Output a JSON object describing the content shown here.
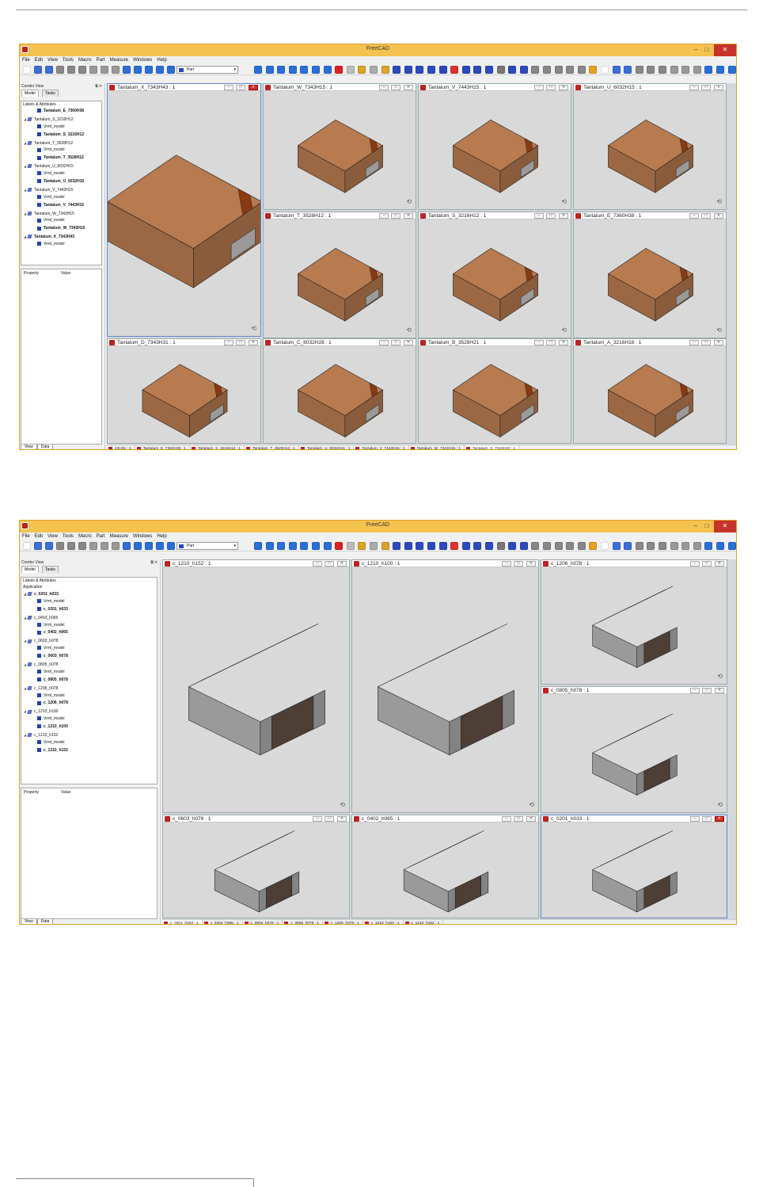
{
  "window1": {
    "title": "FreeCAD",
    "menu": [
      "File",
      "Edit",
      "View",
      "Tools",
      "Macro",
      "Part",
      "Measure",
      "Windows",
      "Help"
    ],
    "workbench": "Part",
    "combo_view": "Combo View",
    "tabs": [
      "Model",
      "Tasks"
    ],
    "tree_header": "Labels & Attributes",
    "tree": [
      {
        "label": "Tantalum_E_7360H38",
        "level": 1,
        "bold": true
      },
      {
        "label": "Tantalum_S_3216H12",
        "level": 0,
        "bold": false
      },
      {
        "label": "Vrml_model",
        "level": 1,
        "bold": false
      },
      {
        "label": "Tantalum_S_3216H12",
        "level": 1,
        "bold": true
      },
      {
        "label": "Tantalum_T_3528H12",
        "level": 0,
        "bold": false
      },
      {
        "label": "Vrml_model",
        "level": 1,
        "bold": false
      },
      {
        "label": "Tantalum_T_3528H12",
        "level": 1,
        "bold": true
      },
      {
        "label": "Tantalum_U_6032H15",
        "level": 0,
        "bold": false
      },
      {
        "label": "Vrml_model",
        "level": 1,
        "bold": false
      },
      {
        "label": "Tantalum_U_6032H15",
        "level": 1,
        "bold": true
      },
      {
        "label": "Tantalum_V_7443H15",
        "level": 0,
        "bold": false
      },
      {
        "label": "Vrml_model",
        "level": 1,
        "bold": false
      },
      {
        "label": "Tantalum_V_7443H15",
        "level": 1,
        "bold": true
      },
      {
        "label": "Tantalum_W_7343H15",
        "level": 0,
        "bold": false
      },
      {
        "label": "Vrml_model",
        "level": 1,
        "bold": false
      },
      {
        "label": "Tantalum_W_7343H15",
        "level": 1,
        "bold": true
      },
      {
        "label": "Tantalum_X_7343H43",
        "level": 0,
        "bold": true
      },
      {
        "label": "Vrml_model",
        "level": 1,
        "bold": false
      }
    ],
    "prop_cols": [
      "Property",
      "Value"
    ],
    "bottom_tabs": [
      "View",
      "Data"
    ],
    "views": [
      "Tantalum_X_7343H43 : 1",
      "Tantalum_W_7343H15 : 1",
      "Tantalum_V_7443H15 : 1",
      "Tantalum_U_6032H15 : 1",
      "Tantalum_T_3528H12 : 1",
      "Tantalum_S_3216H12 : 1",
      "Tantalum_E_7360H38 : 1",
      "Tantalum_D_7343H31 : 1",
      "Tantalum_C_6032H28 : 1",
      "Tantalum_B_3528H21 : 1",
      "Tantalum_A_3216H18 : 1"
    ],
    "doc_tabs": [
      "43H31 : 1",
      "Tantalum_E_7360H38 : 1",
      "Tantalum_S_3216H12 : 1",
      "Tantalum_T_3528H12 : 1",
      "Tantalum_U_6032H15 : 1",
      "Tantalum_V_7443H15 : 1",
      "Tantalum_W_7343H15 : 1",
      "Tantalum_X_7343H43 : 1"
    ]
  },
  "window2": {
    "title": "FreeCAD",
    "menu": [
      "File",
      "Edit",
      "View",
      "Tools",
      "Macro",
      "Part",
      "Measure",
      "Windows",
      "Help"
    ],
    "workbench": "Part",
    "combo_view": "Combo View",
    "tabs": [
      "Model",
      "Tasks"
    ],
    "tree_header": "Labels & Attributes",
    "tree_app": "Application",
    "tree": [
      {
        "label": "c_0201_h033",
        "level": 0,
        "bold": true
      },
      {
        "label": "Vrml_model",
        "level": 1,
        "bold": false
      },
      {
        "label": "c_0201_h033",
        "level": 1,
        "bold": true
      },
      {
        "label": "c_0402_h065",
        "level": 0,
        "bold": false
      },
      {
        "label": "Vrml_model",
        "level": 1,
        "bold": false
      },
      {
        "label": "c_0402_h065",
        "level": 1,
        "bold": true
      },
      {
        "label": "c_0603_h078",
        "level": 0,
        "bold": false
      },
      {
        "label": "Vrml_model",
        "level": 1,
        "bold": false
      },
      {
        "label": "c_0603_h078",
        "level": 1,
        "bold": true
      },
      {
        "label": "c_0805_h078",
        "level": 0,
        "bold": false
      },
      {
        "label": "Vrml_model",
        "level": 1,
        "bold": false
      },
      {
        "label": "c_0805_h078",
        "level": 1,
        "bold": true
      },
      {
        "label": "c_1206_h078",
        "level": 0,
        "bold": false
      },
      {
        "label": "Vrml_model",
        "level": 1,
        "bold": false
      },
      {
        "label": "c_1206_h078",
        "level": 1,
        "bold": true
      },
      {
        "label": "c_1210_h100",
        "level": 0,
        "bold": false
      },
      {
        "label": "Vrml_model",
        "level": 1,
        "bold": false
      },
      {
        "label": "c_1210_h100",
        "level": 1,
        "bold": true
      },
      {
        "label": "c_1210_h152",
        "level": 0,
        "bold": false
      },
      {
        "label": "Vrml_model",
        "level": 1,
        "bold": false
      },
      {
        "label": "c_1210_h152",
        "level": 1,
        "bold": true
      }
    ],
    "prop_cols": [
      "Property",
      "Value"
    ],
    "bottom_tabs": [
      "View",
      "Data"
    ],
    "views": [
      "c_1210_h152 : 1",
      "c_1210_h100 : 1",
      "c_1206_h078 : 1",
      "c_0805_h078 : 1",
      "c_0603_h078 : 1",
      "c_0402_h065 : 1",
      "c_0201_h033 : 1"
    ],
    "doc_tabs": [
      "c_0201_h033 : 1",
      "c_0402_h065 : 1",
      "c_0603_h078 : 1",
      "c_0805_h078 : 1",
      "c_1206_h078 : 1",
      "c_1210_h100 : 1",
      "c_1210_h152 : 1"
    ]
  },
  "colors": {
    "accent": "#f4c24f",
    "close": "#c7332b",
    "tantalum": "#b87a4f",
    "band": "#8a3a12",
    "ceramic": "#5a4a40",
    "terminal": "#9a9a9a",
    "viewbg": "#d9d9d9"
  }
}
